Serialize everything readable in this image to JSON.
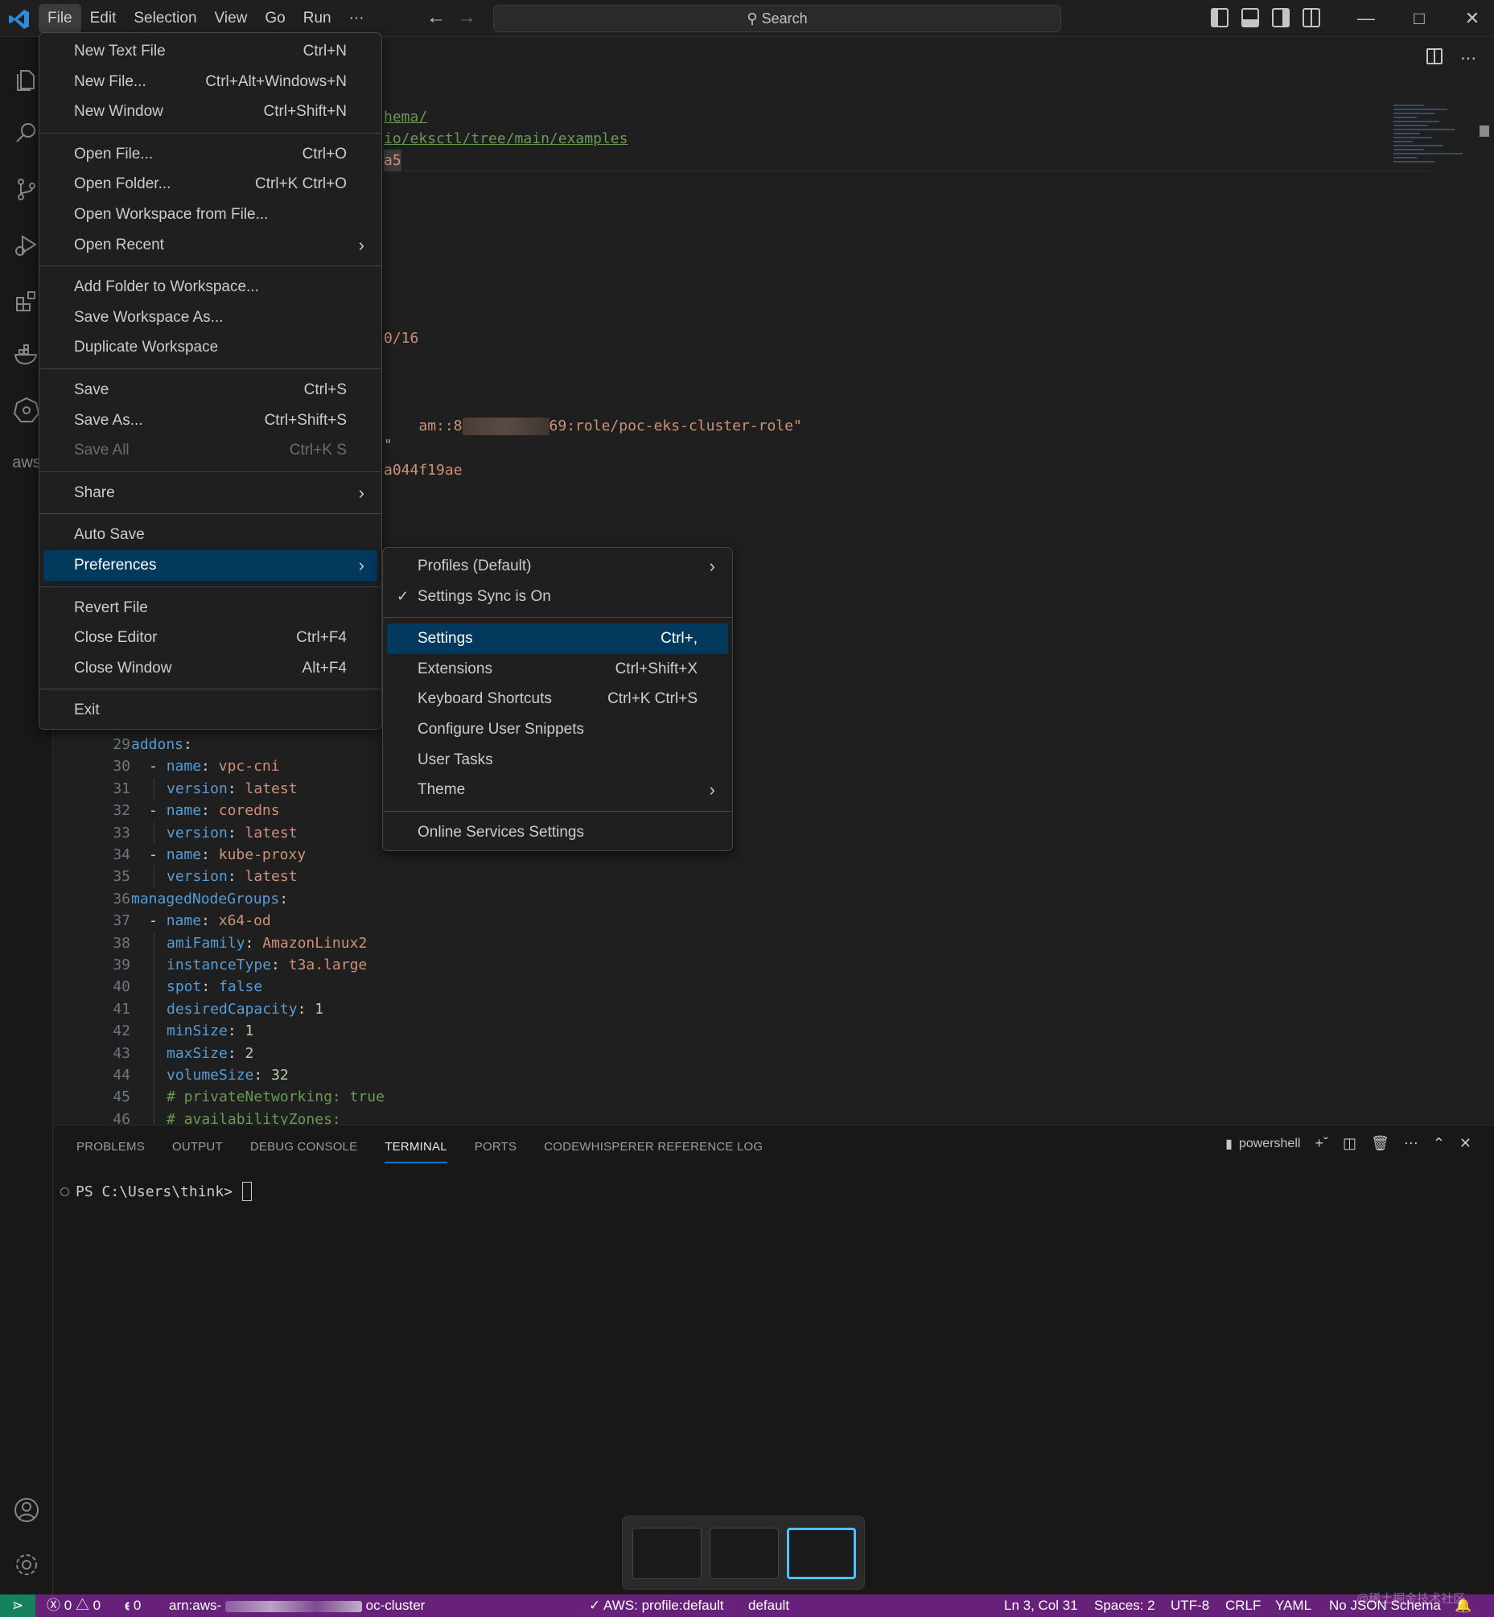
{
  "titlebar": {
    "menus": [
      "File",
      "Edit",
      "Selection",
      "View",
      "Go",
      "Run",
      "···"
    ],
    "search_placeholder": "Search",
    "nav_back_icon": "arrow-left-icon",
    "nav_forward_icon": "arrow-right-icon"
  },
  "file_menu": {
    "groups": [
      [
        {
          "label": "New Text File",
          "shortcut": "Ctrl+N"
        },
        {
          "label": "New File...",
          "shortcut": "Ctrl+Alt+Windows+N"
        },
        {
          "label": "New Window",
          "shortcut": "Ctrl+Shift+N"
        }
      ],
      [
        {
          "label": "Open File...",
          "shortcut": "Ctrl+O"
        },
        {
          "label": "Open Folder...",
          "shortcut": "Ctrl+K Ctrl+O"
        },
        {
          "label": "Open Workspace from File...",
          "shortcut": ""
        },
        {
          "label": "Open Recent",
          "shortcut": "",
          "submenu": true
        }
      ],
      [
        {
          "label": "Add Folder to Workspace...",
          "shortcut": ""
        },
        {
          "label": "Save Workspace As...",
          "shortcut": ""
        },
        {
          "label": "Duplicate Workspace",
          "shortcut": ""
        }
      ],
      [
        {
          "label": "Save",
          "shortcut": "Ctrl+S"
        },
        {
          "label": "Save As...",
          "shortcut": "Ctrl+Shift+S"
        },
        {
          "label": "Save All",
          "shortcut": "Ctrl+K S",
          "disabled": true
        }
      ],
      [
        {
          "label": "Share",
          "shortcut": "",
          "submenu": true
        }
      ],
      [
        {
          "label": "Auto Save",
          "shortcut": ""
        },
        {
          "label": "Preferences",
          "shortcut": "",
          "submenu": true,
          "highlighted": true
        }
      ],
      [
        {
          "label": "Revert File",
          "shortcut": ""
        },
        {
          "label": "Close Editor",
          "shortcut": "Ctrl+F4"
        },
        {
          "label": "Close Window",
          "shortcut": "Alt+F4"
        }
      ],
      [
        {
          "label": "Exit",
          "shortcut": ""
        }
      ]
    ]
  },
  "preferences_menu": {
    "groups": [
      [
        {
          "label": "Profiles (Default)",
          "shortcut": "",
          "submenu": true
        },
        {
          "label": "Settings Sync is On",
          "shortcut": "",
          "checked": true
        }
      ],
      [
        {
          "label": "Settings",
          "shortcut": "Ctrl+,",
          "highlighted": true
        },
        {
          "label": "Extensions",
          "shortcut": "Ctrl+Shift+X"
        },
        {
          "label": "Keyboard Shortcuts",
          "shortcut": "Ctrl+K Ctrl+S"
        },
        {
          "label": "Configure User Snippets",
          "shortcut": ""
        },
        {
          "label": "User Tasks",
          "shortcut": ""
        },
        {
          "label": "Theme",
          "shortcut": "",
          "submenu": true
        }
      ],
      [
        {
          "label": "Online Services Settings",
          "shortcut": ""
        }
      ]
    ]
  },
  "editor_partial_lines": {
    "l1": "hema/",
    "l2": "io/eksctl/tree/main/examples",
    "l3": "a5",
    "l4": "0/16",
    "l5_pre": "am::8",
    "l5_post": "69:role/poc-eks-cluster-role\"",
    "l6": "\"",
    "l7": "a044f19ae"
  },
  "code_lines": [
    {
      "n": "29",
      "indent": 0,
      "dash": false,
      "key": "addons",
      "sep": ":",
      "val": "",
      "type": ""
    },
    {
      "n": "30",
      "indent": 1,
      "dash": true,
      "key": "name",
      "sep": ": ",
      "val": "vpc-cni",
      "type": "v"
    },
    {
      "n": "31",
      "indent": 2,
      "dash": false,
      "key": "version",
      "sep": ": ",
      "val": "latest",
      "type": "v"
    },
    {
      "n": "32",
      "indent": 1,
      "dash": true,
      "key": "name",
      "sep": ": ",
      "val": "coredns",
      "type": "v"
    },
    {
      "n": "33",
      "indent": 2,
      "dash": false,
      "key": "version",
      "sep": ": ",
      "val": "latest",
      "type": "v"
    },
    {
      "n": "34",
      "indent": 1,
      "dash": true,
      "key": "name",
      "sep": ": ",
      "val": "kube-proxy",
      "type": "v"
    },
    {
      "n": "35",
      "indent": 2,
      "dash": false,
      "key": "version",
      "sep": ": ",
      "val": "latest",
      "type": "v"
    },
    {
      "n": "36",
      "indent": 0,
      "dash": false,
      "key": "managedNodeGroups",
      "sep": ":",
      "val": "",
      "type": ""
    },
    {
      "n": "37",
      "indent": 1,
      "dash": true,
      "key": "name",
      "sep": ": ",
      "val": "x64-od",
      "type": "v"
    },
    {
      "n": "38",
      "indent": 2,
      "dash": false,
      "key": "amiFamily",
      "sep": ": ",
      "val": "AmazonLinux2",
      "type": "v"
    },
    {
      "n": "39",
      "indent": 2,
      "dash": false,
      "key": "instanceType",
      "sep": ": ",
      "val": "t3a.large",
      "type": "v"
    },
    {
      "n": "40",
      "indent": 2,
      "dash": false,
      "key": "spot",
      "sep": ": ",
      "val": "false",
      "type": "k"
    },
    {
      "n": "41",
      "indent": 2,
      "dash": false,
      "key": "desiredCapacity",
      "sep": ": ",
      "val": "1",
      "type": "n"
    },
    {
      "n": "42",
      "indent": 2,
      "dash": false,
      "key": "minSize",
      "sep": ": ",
      "val": "1",
      "type": "n"
    },
    {
      "n": "43",
      "indent": 2,
      "dash": false,
      "key": "maxSize",
      "sep": ": ",
      "val": "2",
      "type": "n"
    },
    {
      "n": "44",
      "indent": 2,
      "dash": false,
      "key": "volumeSize",
      "sep": ": ",
      "val": "32",
      "type": "n"
    },
    {
      "n": "45",
      "indent": 2,
      "dash": false,
      "comment": "# privateNetworking: true"
    },
    {
      "n": "46",
      "indent": 2,
      "dash": false,
      "comment": "# availabilityZones:"
    }
  ],
  "panel": {
    "tabs": [
      "PROBLEMS",
      "OUTPUT",
      "DEBUG CONSOLE",
      "TERMINAL",
      "PORTS",
      "CODEWHISPERER REFERENCE LOG"
    ],
    "active_tab": "TERMINAL",
    "shell": "powershell",
    "prompt": "PS C:\\Users\\think>"
  },
  "statusbar": {
    "errors": "0",
    "warnings": "0",
    "ports": "0",
    "arn_prefix": "arn:aws-",
    "arn_suffix": "oc-cluster",
    "aws_profile": "AWS: profile:default",
    "aws_default": "default",
    "position": "Ln 3, Col 31",
    "spaces": "Spaces: 2",
    "encoding": "UTF-8",
    "eol": "CRLF",
    "language": "YAML",
    "schema": "No JSON Schema",
    "watermark": "@稀土掘金技术社区"
  },
  "colors": {
    "statusbar": "#68217a",
    "remote": "#16825d",
    "menu_highlight": "#04395e",
    "tab_active": "#0078d4"
  }
}
